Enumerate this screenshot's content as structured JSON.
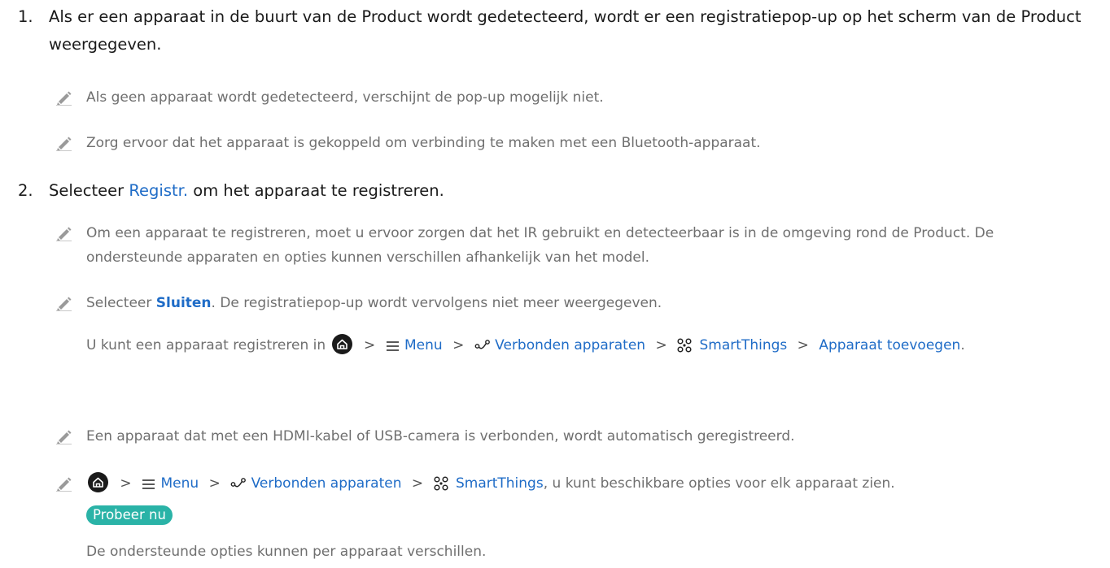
{
  "step1": {
    "number": "1.",
    "text": "Als er een apparaat in de buurt van de Product wordt gedetecteerd, wordt er een registratiepop-up op het scherm van de Product weergegeven."
  },
  "notes1": [
    "Als geen apparaat wordt gedetecteerd, verschijnt de pop-up mogelijk niet.",
    "Zorg ervoor dat het apparaat is gekoppeld om verbinding te maken met een Bluetooth-apparaat."
  ],
  "step2": {
    "number": "2.",
    "text_before": "Selecteer ",
    "link": "Registr.",
    "text_after": " om het apparaat te registreren."
  },
  "notes2": {
    "ir": "Om een apparaat te registreren, moet u ervoor zorgen dat het IR gebruikt en detecteerbaar is in de omgeving rond de Product. De ondersteunde apparaten en opties kunnen verschillen afhankelijk van het model.",
    "close_before": "Selecteer ",
    "close_link": "Sluiten",
    "close_after": ". De registratiepop-up wordt vervolgens niet meer weergegeven.",
    "path_intro": "U kunt een apparaat registreren in",
    "hdmi": "Een apparaat dat met een HDMI-kabel of USB-camera is verbonden, wordt automatisch geregistreerd.",
    "path_suffix": ", u kunt beschikbare opties voor elk apparaat zien.",
    "try_now": "Probeer nu",
    "options_note": "De ondersteunde opties kunnen per apparaat verschillen."
  },
  "menu_path": {
    "menu": "Menu",
    "connected": "Verbonden apparaten",
    "smartthings": "SmartThings",
    "add_device": "Apparaat toevoegen",
    "separator": ">"
  },
  "colors": {
    "link": "#1f6cc7",
    "note_text": "#6f6f6f",
    "badge": "#2ab3a7"
  },
  "icons": [
    "pencil-icon",
    "home-icon",
    "menu-icon",
    "connected-devices-icon",
    "smartthings-icon"
  ]
}
